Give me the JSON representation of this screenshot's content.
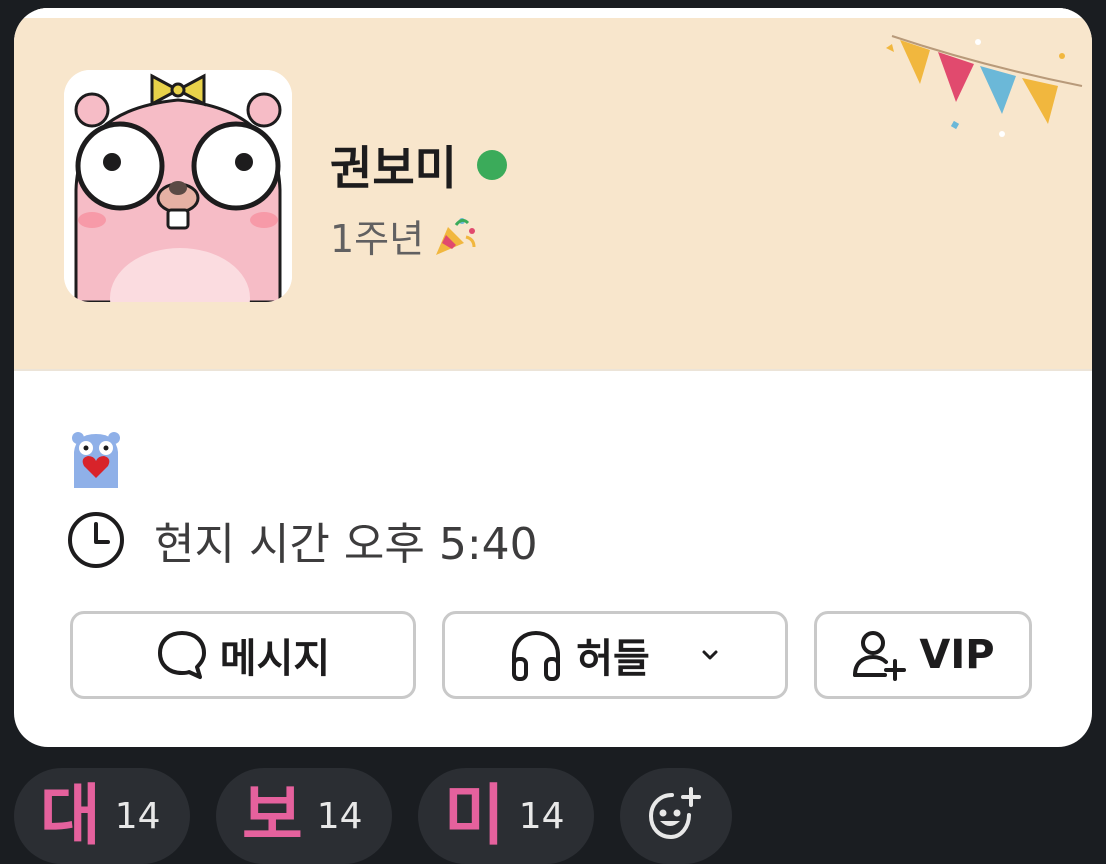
{
  "profile": {
    "name": "권보미",
    "presence": "online",
    "anniversary": "1주년",
    "local_time": "현지 시간 오후 5:40"
  },
  "buttons": {
    "message_label": "메시지",
    "huddle_label": "허들",
    "vip_label": "VIP"
  },
  "reactions": [
    {
      "emoji": "대",
      "count": "14"
    },
    {
      "emoji": "보",
      "count": "14"
    },
    {
      "emoji": "미",
      "count": "14"
    }
  ],
  "icons": {
    "presence": "green-dot",
    "anniversary": "party-popper-icon",
    "status": "gopher-heart-icon",
    "clock": "clock-icon",
    "message": "speech-bubble-icon",
    "huddle": "headphones-icon",
    "huddle_menu": "chevron-down-icon",
    "vip": "user-plus-icon",
    "add_reaction": "add-reaction-icon"
  },
  "colors": {
    "banner": "#f8e6cc",
    "presence_online": "#3bab5a",
    "reaction_text": "#e5619d",
    "dark_bg": "#1a1d21"
  }
}
